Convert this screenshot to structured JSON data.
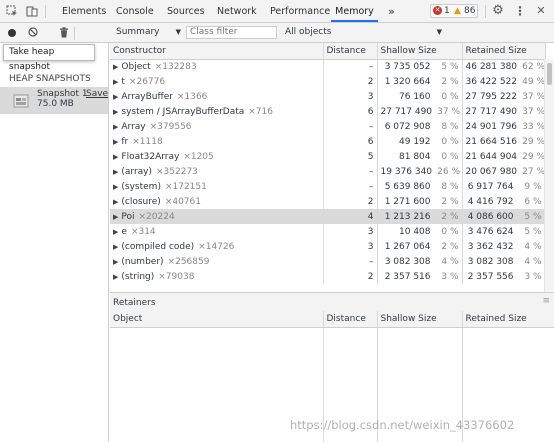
{
  "tabs": [
    "Elements",
    "Console",
    "Sources",
    "Network",
    "Performance",
    "Memory"
  ],
  "more_tabs_icon": "»",
  "errors": {
    "count": "1",
    "color": "#d93025"
  },
  "warnings": {
    "count": "86",
    "color": "#f29900"
  },
  "toolbar": {
    "view_select": "Summary",
    "class_filter_placeholder": "Class filter",
    "objects_select": "All objects"
  },
  "tooltip": "Take heap snapshot",
  "sidebar": {
    "section_title": "HEAP SNAPSHOTS",
    "snapshot": {
      "name": "Snapshot 1",
      "size": "75.0 MB",
      "save_label": "Save"
    }
  },
  "table": {
    "headers": [
      "Constructor",
      "Distance",
      "Shallow Size",
      "Retained Size"
    ],
    "rows": [
      {
        "name": "Object",
        "count": "×132283",
        "distance": "–",
        "shallow": "3 735 052",
        "shallow_pct": "5 %",
        "retained": "46 281 380",
        "retained_pct": "62 %"
      },
      {
        "name": "t",
        "count": "×26776",
        "distance": "2",
        "shallow": "1 320 664",
        "shallow_pct": "2 %",
        "retained": "36 422 522",
        "retained_pct": "49 %"
      },
      {
        "name": "ArrayBuffer",
        "count": "×1366",
        "distance": "3",
        "shallow": "76 160",
        "shallow_pct": "0 %",
        "retained": "27 795 222",
        "retained_pct": "37 %"
      },
      {
        "name": "system / JSArrayBufferData",
        "count": "×716",
        "distance": "6",
        "shallow": "27 717 490",
        "shallow_pct": "37 %",
        "retained": "27 717 490",
        "retained_pct": "37 %"
      },
      {
        "name": "Array",
        "count": "×379556",
        "distance": "–",
        "shallow": "6 072 908",
        "shallow_pct": "8 %",
        "retained": "24 901 796",
        "retained_pct": "33 %"
      },
      {
        "name": "fr",
        "count": "×1118",
        "distance": "6",
        "shallow": "49 192",
        "shallow_pct": "0 %",
        "retained": "21 664 516",
        "retained_pct": "29 %"
      },
      {
        "name": "Float32Array",
        "count": "×1205",
        "distance": "5",
        "shallow": "81 804",
        "shallow_pct": "0 %",
        "retained": "21 644 904",
        "retained_pct": "29 %"
      },
      {
        "name": "(array)",
        "count": "×352273",
        "distance": "–",
        "shallow": "19 376 340",
        "shallow_pct": "26 %",
        "retained": "20 067 980",
        "retained_pct": "27 %"
      },
      {
        "name": "(system)",
        "count": "×172151",
        "distance": "–",
        "shallow": "5 639 860",
        "shallow_pct": "8 %",
        "retained": "6 917 764",
        "retained_pct": "9 %"
      },
      {
        "name": "(closure)",
        "count": "×40761",
        "distance": "2",
        "shallow": "1 271 600",
        "shallow_pct": "2 %",
        "retained": "4 416 792",
        "retained_pct": "6 %"
      },
      {
        "name": "Poi",
        "count": "×20224",
        "distance": "4",
        "shallow": "1 213 216",
        "shallow_pct": "2 %",
        "retained": "4 086 600",
        "retained_pct": "5 %",
        "selected": true
      },
      {
        "name": "e",
        "count": "×314",
        "distance": "3",
        "shallow": "10 408",
        "shallow_pct": "0 %",
        "retained": "3 476 624",
        "retained_pct": "5 %"
      },
      {
        "name": "(compiled code)",
        "count": "×14726",
        "distance": "3",
        "shallow": "1 267 064",
        "shallow_pct": "2 %",
        "retained": "3 362 432",
        "retained_pct": "4 %"
      },
      {
        "name": "(number)",
        "count": "×256859",
        "distance": "–",
        "shallow": "3 082 308",
        "shallow_pct": "4 %",
        "retained": "3 082 308",
        "retained_pct": "4 %"
      },
      {
        "name": "(string)",
        "count": "×79038",
        "distance": "2",
        "shallow": "2 357 516",
        "shallow_pct": "3 %",
        "retained": "2 357 556",
        "retained_pct": "3 %"
      }
    ]
  },
  "retainers": {
    "title": "Retainers",
    "headers": [
      "Object",
      "Distance",
      "Shallow Size",
      "Retained Size"
    ]
  },
  "watermark": "https://blog.csdn.net/weixin_43376602",
  "colors": {
    "active_tab": "#1a73e8",
    "selected_row": "#dadada",
    "sidebar_selected": "#dadada"
  }
}
